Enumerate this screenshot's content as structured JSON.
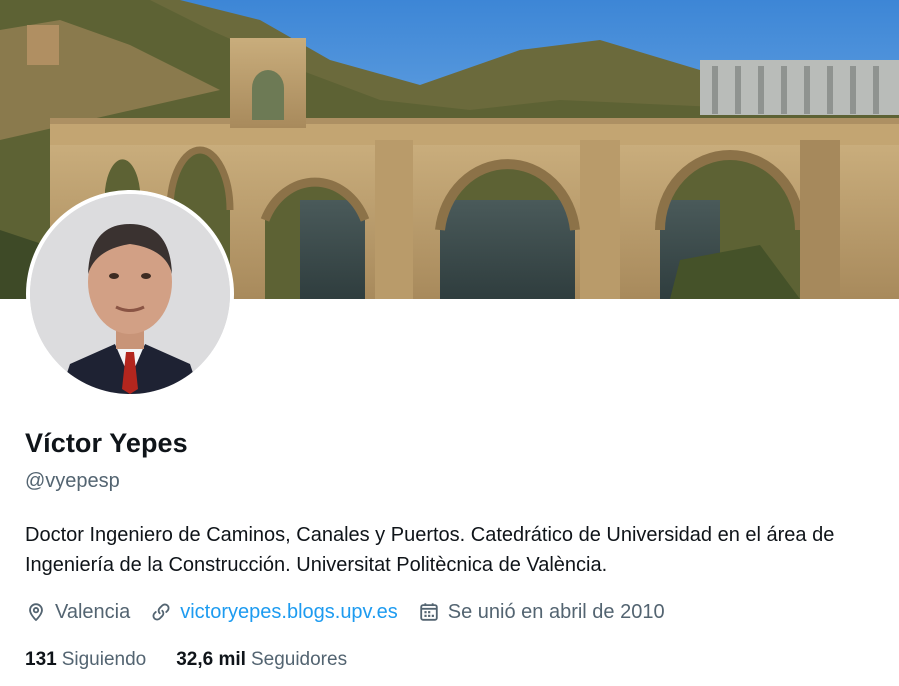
{
  "profile": {
    "display_name": "Víctor Yepes",
    "handle": "@vyepesp",
    "bio": "Doctor Ingeniero de Caminos, Canales y Puertos. Catedrático de Universidad en el área de Ingeniería de la Construcción. Universitat Politècnica de València.",
    "location": "Valencia",
    "website": "victoryepes.blogs.upv.es",
    "joined": "Se unió en abril de 2010"
  },
  "stats": {
    "following_count": "131",
    "following_label": "Siguiendo",
    "followers_count": "32,6 mil",
    "followers_label": "Seguidores"
  },
  "icons": {
    "location": "location-pin-icon",
    "website": "link-icon",
    "joined": "calendar-icon"
  },
  "colors": {
    "link": "#1d9bf0",
    "secondary_text": "#536471",
    "primary_text": "#0f1419"
  }
}
